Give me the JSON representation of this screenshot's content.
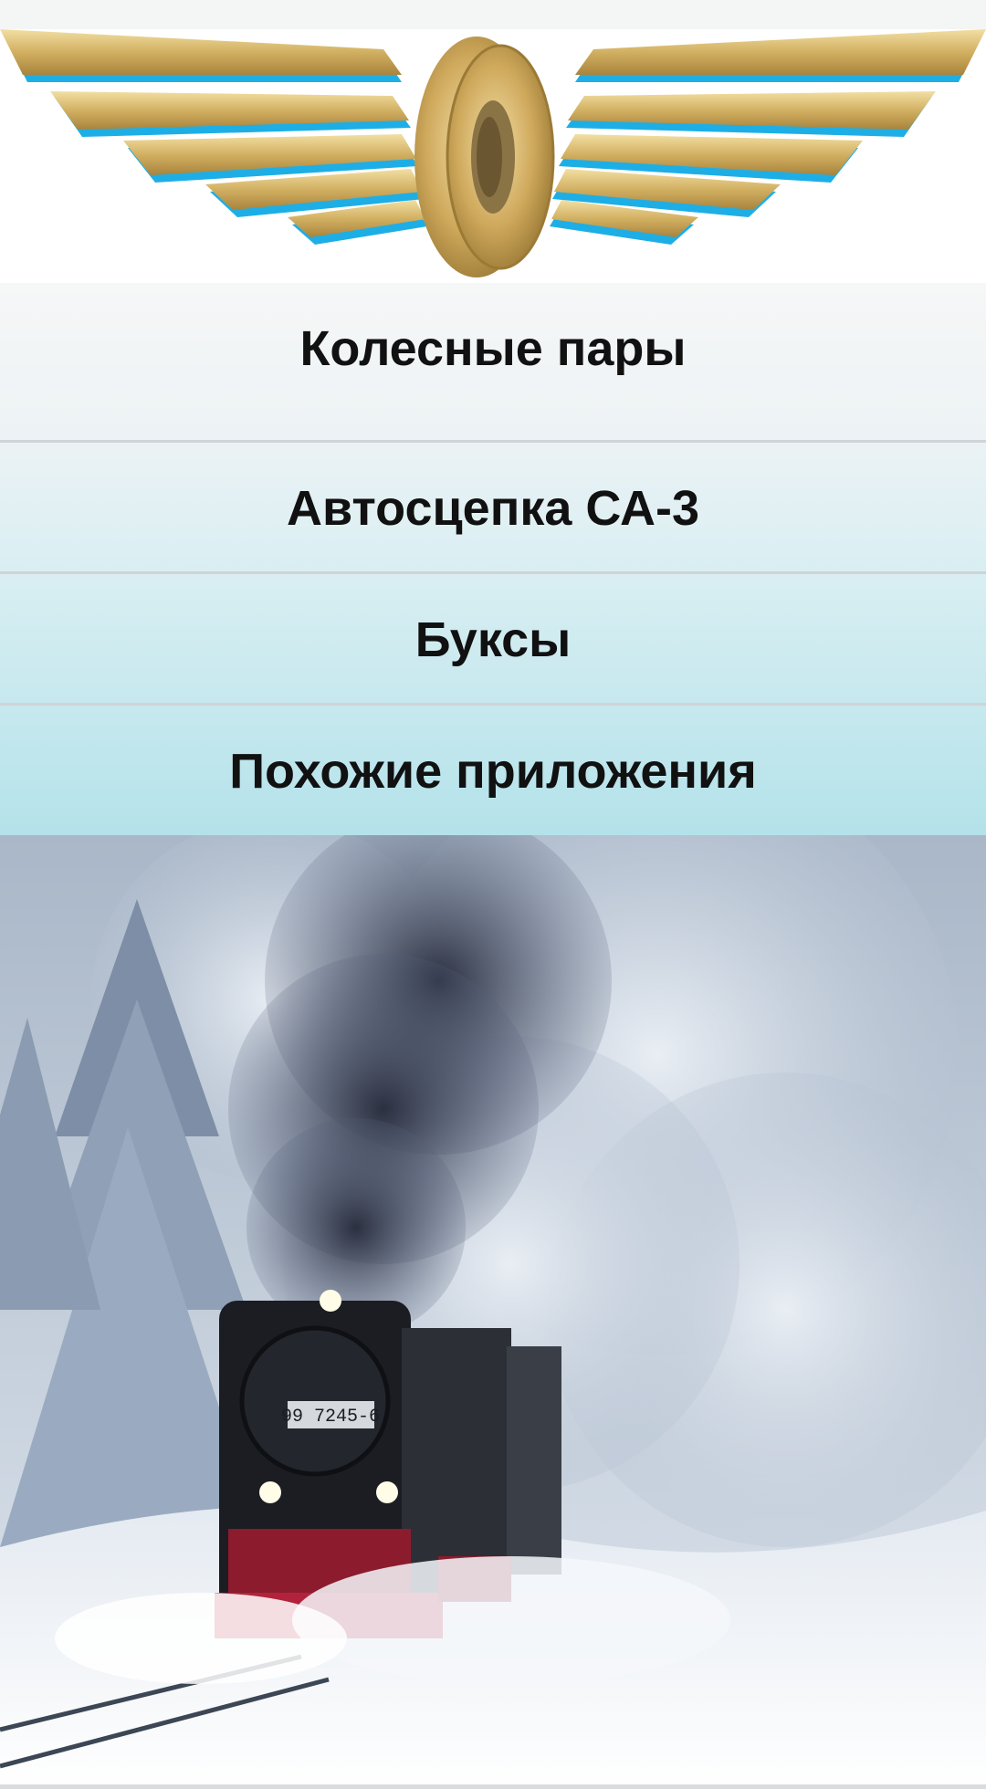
{
  "menu": {
    "items": [
      {
        "label": "Колесные пары"
      },
      {
        "label": "Автосцепка СА-3"
      },
      {
        "label": "Буксы"
      },
      {
        "label": "Похожие приложения"
      }
    ]
  },
  "hero": {
    "plate_text": "99 7245-6",
    "icon": "steam-locomotive-in-snow-image"
  },
  "logo": {
    "icon": "winged-wheel-railway-emblem",
    "colors": {
      "gold": "#d4b46a",
      "blue": "#1eaee6"
    }
  }
}
